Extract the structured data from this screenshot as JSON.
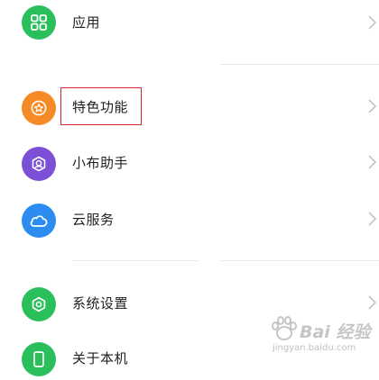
{
  "settings_items": [
    {
      "label": "应用",
      "icon": "grid-icon",
      "color": "#2bbf5c"
    },
    {
      "label": "特色功能",
      "icon": "star-icon",
      "color": "#f68a26"
    },
    {
      "label": "小布助手",
      "icon": "assistant-icon",
      "color": "#7b4fd6"
    },
    {
      "label": "云服务",
      "icon": "cloud-icon",
      "color": "#2d8cf0"
    },
    {
      "label": "系统设置",
      "icon": "settings-hexagon-icon",
      "color": "#2bbf5c"
    },
    {
      "label": "关于本机",
      "icon": "phone-icon",
      "color": "#2bbf5c"
    }
  ],
  "highlight_color": "#d9262c",
  "watermark": {
    "brand": "Bai 经验",
    "url": "jingyan.baidu.com"
  }
}
